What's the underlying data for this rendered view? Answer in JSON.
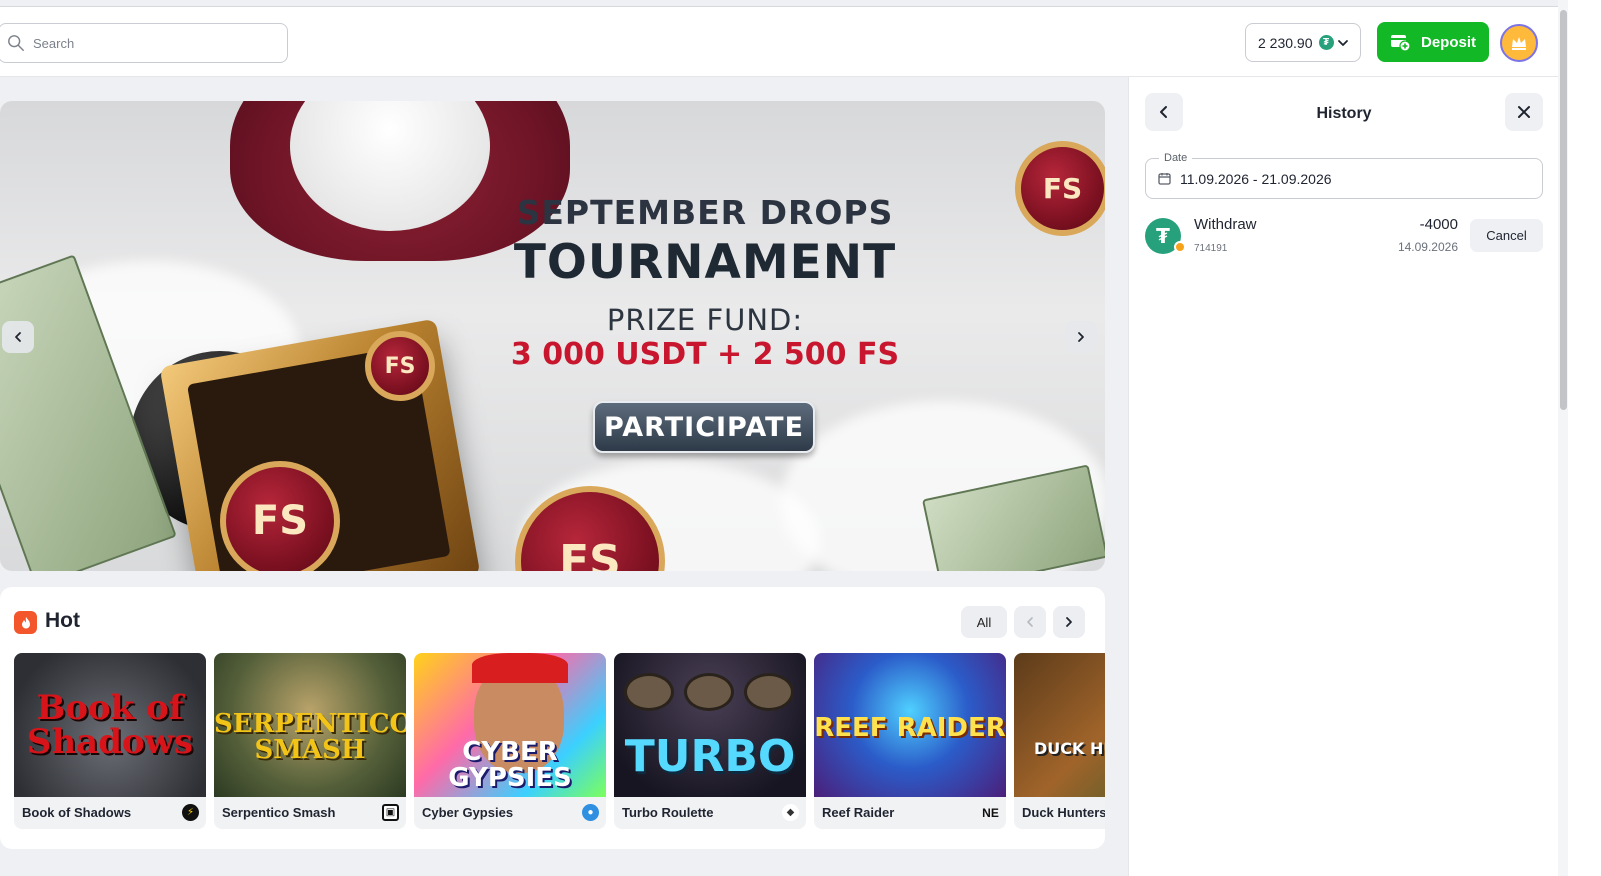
{
  "header": {
    "search_placeholder": "Search",
    "balance": "2 230.90",
    "currency_icon": "tether-icon",
    "deposit_label": "Deposit"
  },
  "banner": {
    "line1": "SEPTEMBER DROPS",
    "line2": "TOURNAMENT",
    "line3": "PRIZE FUND:",
    "line4": "3 000 USDT + 2 500 FS",
    "cta": "PARTICIPATE",
    "coin_text": "FS"
  },
  "hot": {
    "title": "Hot",
    "all_label": "All",
    "games": [
      {
        "name": "Book of Shadows",
        "art": "Book of Shadows",
        "provider_icon": "lightning-icon"
      },
      {
        "name": "Serpentico Smash",
        "art": "SERPENTICO SMASH",
        "provider_icon": "cube-icon"
      },
      {
        "name": "Cyber Gypsies",
        "art": "CYBER GYPSIES",
        "provider_icon": "drop-icon"
      },
      {
        "name": "Turbo Roulette",
        "art": "TURBO",
        "provider_icon": "owl-icon"
      },
      {
        "name": "Reef Raider",
        "art": "REEF RAIDER",
        "provider_icon": "NE"
      },
      {
        "name": "Duck Hunters",
        "art": "DUCK HU",
        "provider_icon": ""
      }
    ]
  },
  "history": {
    "title": "History",
    "date_label": "Date",
    "date_range": "11.09.2026 - 21.09.2026",
    "transactions": [
      {
        "type": "Withdraw",
        "id": "714191",
        "amount": "-4000",
        "date": "14.09.2026",
        "action": "Cancel"
      }
    ]
  },
  "colors": {
    "deposit_green": "#13b826",
    "tether_green": "#26a17b",
    "prize_red": "#c8162e",
    "hot_orange": "#f4562c"
  }
}
